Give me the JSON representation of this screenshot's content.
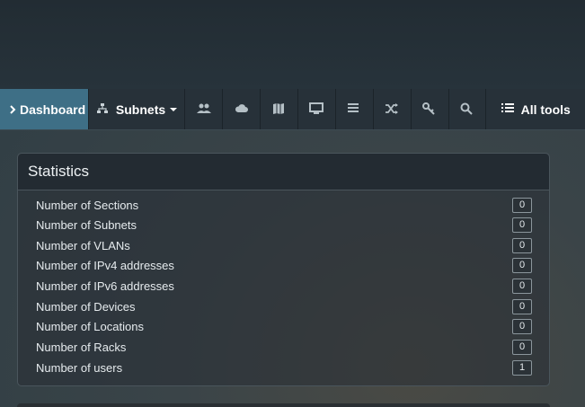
{
  "menu": {
    "dashboard": "Dashboard",
    "subnets": "Subnets",
    "all_tools": "All tools",
    "icons": [
      "users-icon",
      "cloud-icon",
      "map-icon",
      "monitor-icon",
      "list-icon",
      "shuffle-icon",
      "key-icon",
      "search-icon"
    ]
  },
  "statistics": {
    "title": "Statistics",
    "rows": [
      {
        "label": "Number of Sections",
        "value": "0"
      },
      {
        "label": "Number of Subnets",
        "value": "0"
      },
      {
        "label": "Number of VLANs",
        "value": "0"
      },
      {
        "label": "Number of IPv4 addresses",
        "value": "0"
      },
      {
        "label": "Number of IPv6 addresses",
        "value": "0"
      },
      {
        "label": "Number of Devices",
        "value": "0"
      },
      {
        "label": "Number of Locations",
        "value": "0"
      },
      {
        "label": "Number of Racks",
        "value": "0"
      },
      {
        "label": "Number of users",
        "value": "1"
      }
    ]
  },
  "colors": {
    "active_tab": "#3e6f86",
    "menubar": "#273139"
  }
}
